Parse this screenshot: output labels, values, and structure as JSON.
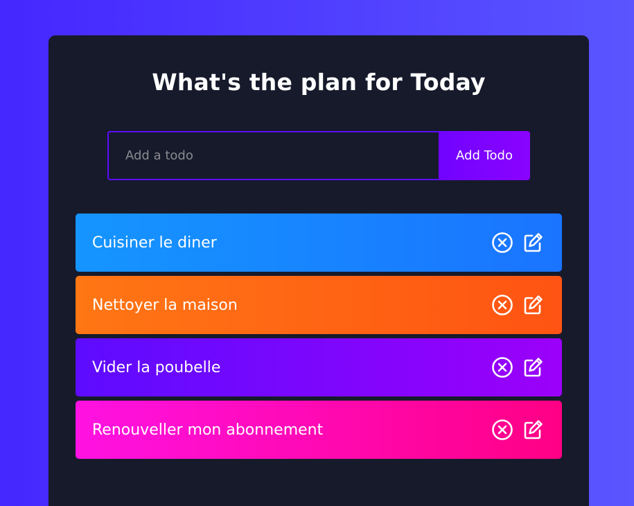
{
  "header": {
    "title": "What's the plan for Today"
  },
  "form": {
    "placeholder": "Add a todo",
    "value": "",
    "button_label": "Add Todo"
  },
  "todos": [
    {
      "text": "Cuisiner le diner",
      "color_start": "#1595ff",
      "color_end": "#1a74ff"
    },
    {
      "text": "Nettoyer la maison",
      "color_start": "#ff7614",
      "color_end": "#ff5413"
    },
    {
      "text": "Vider la poubelle",
      "color_start": "#5d0cff",
      "color_end": "#9b00fa"
    },
    {
      "text": "Renouveller mon abonnement",
      "color_start": "#ff12e2",
      "color_end": "#ff0084"
    }
  ],
  "icons": {
    "delete": "close-circle-icon",
    "edit": "edit-icon"
  },
  "colors": {
    "app_background": "#161a2b",
    "accent": "#5d0cff",
    "text": "#ffffff"
  }
}
